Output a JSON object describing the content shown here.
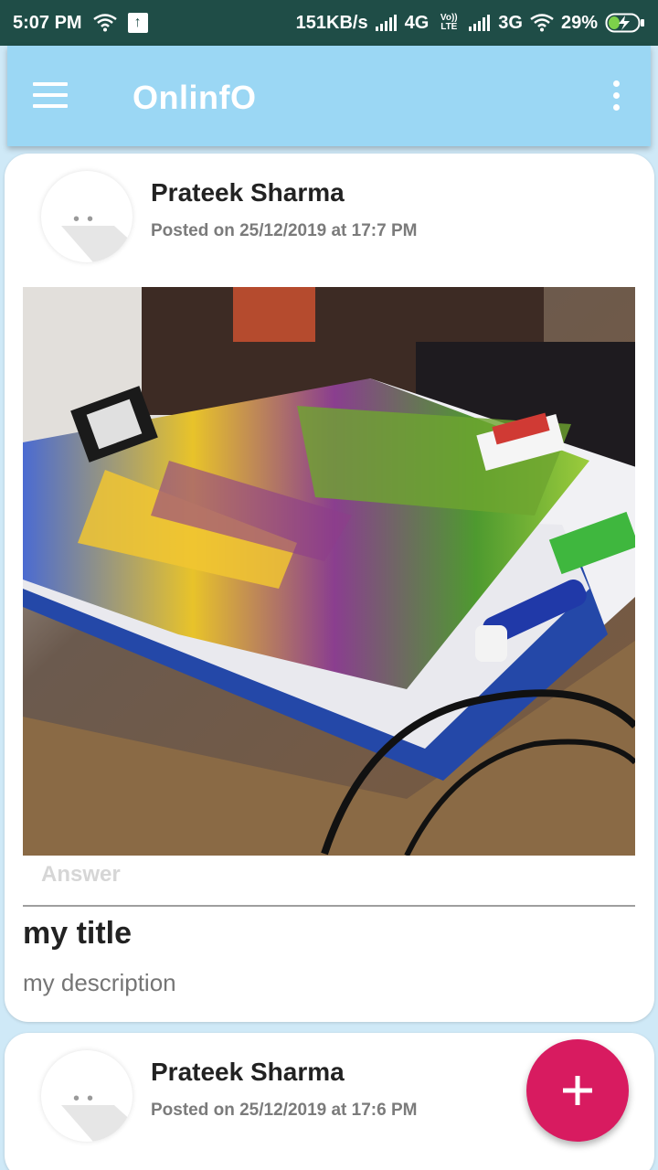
{
  "status_bar": {
    "time": "5:07 PM",
    "speed": "151KB/s",
    "net1": "4G",
    "volte": "Vo)) LTE",
    "net2": "3G",
    "battery": "29%"
  },
  "app_bar": {
    "title": "OnlinfO"
  },
  "posts": [
    {
      "author": "Prateek Sharma",
      "posted": "Posted on 25/12/2019 at 17:7 PM",
      "answer_label": "Answer",
      "title": "my title",
      "description": "my description"
    },
    {
      "author": "Prateek Sharma",
      "posted": "Posted on 25/12/2019 at 17:6 PM"
    }
  ],
  "fab": {
    "label": "+"
  },
  "colors": {
    "status_bar": "#1f4d47",
    "app_bar": "#9bd7f4",
    "background": "#cfe9f7",
    "fab": "#d81b60"
  }
}
